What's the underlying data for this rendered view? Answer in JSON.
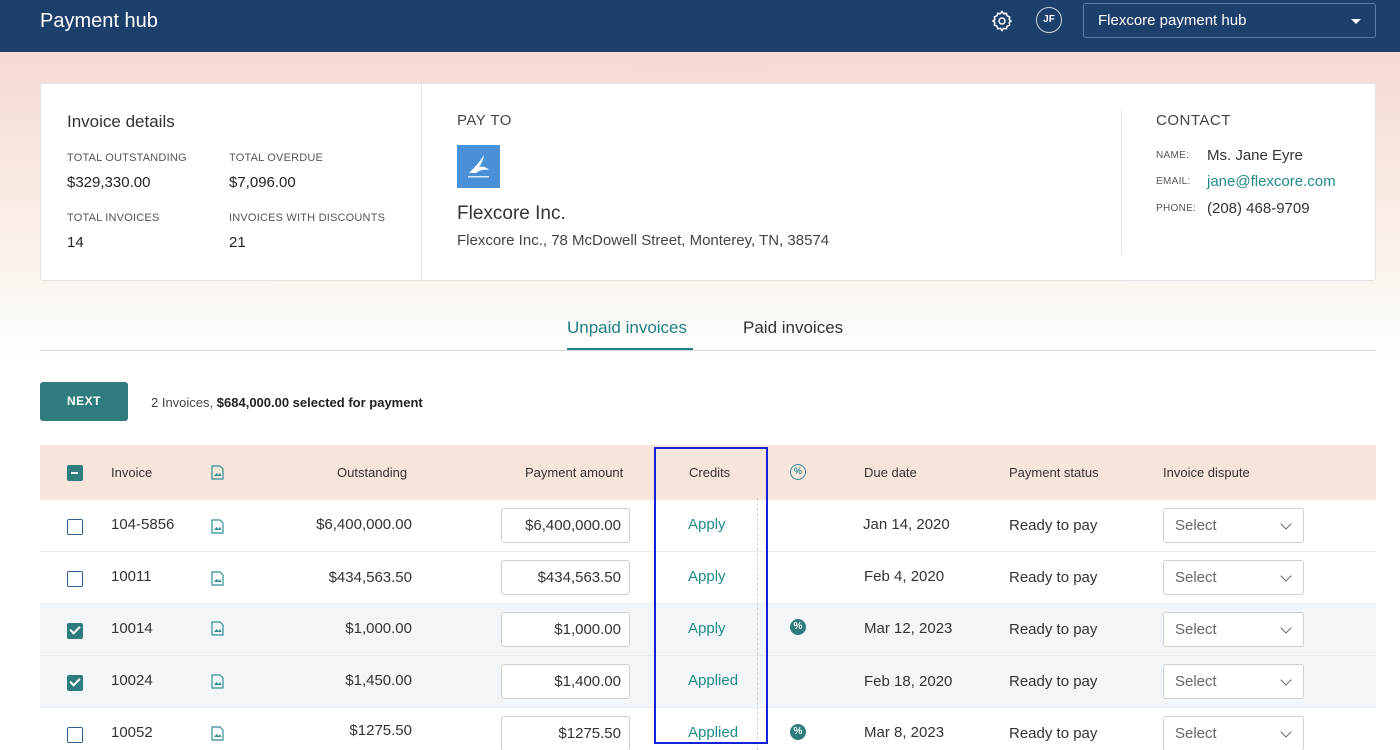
{
  "header": {
    "app_title": "Payment hub",
    "avatar_initials": "JF",
    "hub_selector": "Flexcore payment hub"
  },
  "invoice_details": {
    "title": "Invoice details",
    "total_outstanding_label": "TOTAL OUTSTANDING",
    "total_outstanding": "$329,330.00",
    "total_overdue_label": "TOTAL OVERDUE",
    "total_overdue": "$7,096.00",
    "total_invoices_label": "TOTAL INVOICES",
    "total_invoices": "14",
    "invoices_with_discounts_label": "INVOICES WITH DISCOUNTS",
    "invoices_with_discounts": "21"
  },
  "pay_to": {
    "label": "PAY TO",
    "company": "Flexcore Inc.",
    "address": "Flexcore Inc., 78 McDowell Street, Monterey, TN, 38574"
  },
  "contact": {
    "label": "CONTACT",
    "name_key": "NAME:",
    "name": "Ms. Jane Eyre",
    "email_key": "EMAIL:",
    "email": "jane@flexcore.com",
    "phone_key": "PHONE:",
    "phone": "(208) 468-9709"
  },
  "tabs": {
    "unpaid": "Unpaid invoices",
    "paid": "Paid invoices",
    "active": "unpaid"
  },
  "actions": {
    "next_label": "NEXT",
    "selection_prefix": "2 Invoices,",
    "selection_amount": "$684,000.00 selected for payment"
  },
  "table": {
    "headers": {
      "invoice": "Invoice",
      "outstanding": "Outstanding",
      "payment_amount": "Payment amount",
      "credits": "Credits",
      "discount": "%",
      "due_date": "Due date",
      "payment_status": "Payment status",
      "invoice_dispute": "Invoice dispute"
    },
    "rows": [
      {
        "selected": false,
        "invoice": "104-5856",
        "outstanding": "$6,400,000.00",
        "payment_amount": "$6,400,000.00",
        "credits": "Apply",
        "discount": false,
        "due_date": "Jan 14, 2020",
        "payment_status": "Ready to pay",
        "dispute": "Select"
      },
      {
        "selected": false,
        "invoice": "10011",
        "outstanding": "$434,563.50",
        "payment_amount": "$434,563.50",
        "credits": "Apply",
        "discount": false,
        "due_date": "Feb 4, 2020",
        "payment_status": "Ready to pay",
        "dispute": "Select"
      },
      {
        "selected": true,
        "invoice": "10014",
        "outstanding": "$1,000.00",
        "payment_amount": "$1,000.00",
        "credits": "Apply",
        "discount": true,
        "due_date": "Mar 12, 2023",
        "payment_status": "Ready to pay",
        "dispute": "Select"
      },
      {
        "selected": true,
        "invoice": "10024",
        "outstanding": "$1,450.00",
        "payment_amount": "$1,400.00",
        "credits": "Applied",
        "discount": false,
        "due_date": "Feb 18, 2020",
        "payment_status": "Ready to pay",
        "dispute": "Select"
      },
      {
        "selected": false,
        "invoice": "10052",
        "outstanding": "$1275.50",
        "payment_amount": "$1275.50",
        "credits": "Applied",
        "discount": true,
        "due_date": "Mar 8, 2023",
        "payment_status": "Ready to pay",
        "dispute": "Select"
      }
    ]
  },
  "colors": {
    "header_bg": "#1d3f6b",
    "accent": "#2f7c7f",
    "link": "#1e8a8a",
    "table_header_bg": "#f7e5dc",
    "highlight_box": "#1523d8"
  }
}
